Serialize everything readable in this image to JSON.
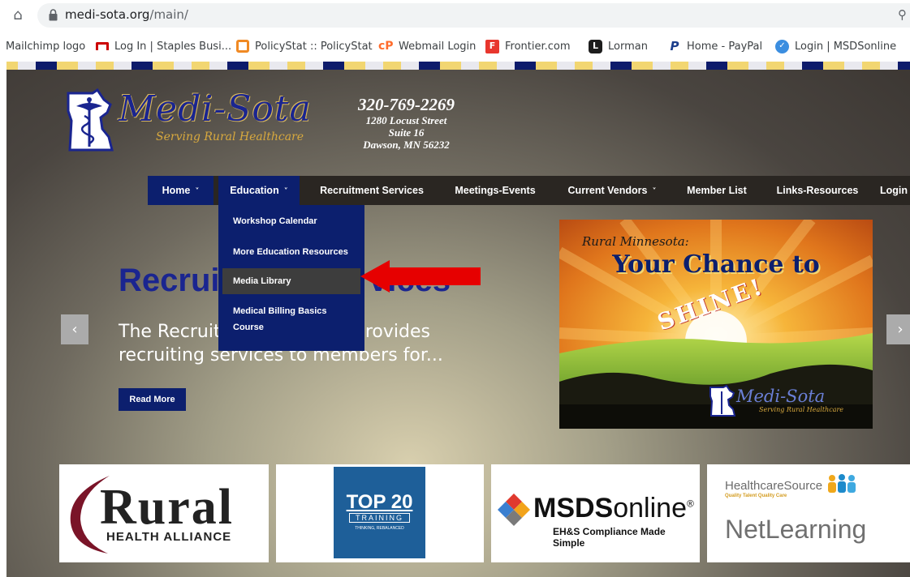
{
  "browser": {
    "url_main": "medi-sota.org",
    "url_path": "/main/",
    "bookmarks": [
      {
        "label": "Mailchimp logo",
        "icon": "mailchimp-icon"
      },
      {
        "label": "Log In | Staples Busi...",
        "icon": "staples-icon"
      },
      {
        "label": "PolicyStat :: PolicyStat",
        "icon": "policystat-icon"
      },
      {
        "label": "Webmail Login",
        "icon": "cpanel-icon"
      },
      {
        "label": "Frontier.com",
        "icon": "frontier-icon"
      },
      {
        "label": "Lorman",
        "icon": "lorman-icon"
      },
      {
        "label": "Home - PayPal",
        "icon": "paypal-icon"
      },
      {
        "label": "Login | MSDSonline",
        "icon": "msdsonline-icon"
      }
    ]
  },
  "header": {
    "logo_title": "Medi-Sota",
    "logo_subtitle": "Serving Rural Healthcare",
    "phone": "320-769-2269",
    "street": "1280 Locust Street",
    "suite": "Suite 16",
    "city": "Dawson, MN 56232"
  },
  "nav": {
    "items": [
      {
        "label": "Home",
        "chevron": "˅"
      },
      {
        "label": "Education",
        "chevron": "˅"
      },
      {
        "label": "Recruitment Services"
      },
      {
        "label": "Meetings-Events"
      },
      {
        "label": "Current Vendors",
        "chevron": "˅"
      },
      {
        "label": "Member List"
      },
      {
        "label": "Links-Resources"
      },
      {
        "label": "Login"
      }
    ],
    "dropdown": [
      {
        "label": "Workshop Calendar"
      },
      {
        "label": "More Education Resources"
      },
      {
        "label": "Media Library"
      },
      {
        "label": "Medical Billing Basics"
      },
      {
        "label": "Course"
      }
    ]
  },
  "hero": {
    "title": "Recruitment Services",
    "text": "The Recruitment Services provides recruiting services to members for...",
    "read_more": "Read More",
    "prev": "‹",
    "next": "›"
  },
  "banner": {
    "pre_title": "Rural Minnesota:",
    "title": "Your Chance to",
    "shine": "SHINE!",
    "logo": "Medi-Sota",
    "logo_sub": "Serving Rural Healthcare"
  },
  "sponsors": {
    "rural": "Rural",
    "rural_sub": "HEALTH ALLIANCE",
    "top20": "TOP 20",
    "top20_training": "TRAINING",
    "top20_tag": "THINKING, REBALANCED",
    "msds_bold": "MSDS",
    "msds_rest": "online",
    "msds_sub": "EH&S Compliance Made Simple",
    "hcs": "HealthcareSource",
    "hcs_tag": "Quality Talent  Quality Care",
    "net": "NetLearning"
  }
}
